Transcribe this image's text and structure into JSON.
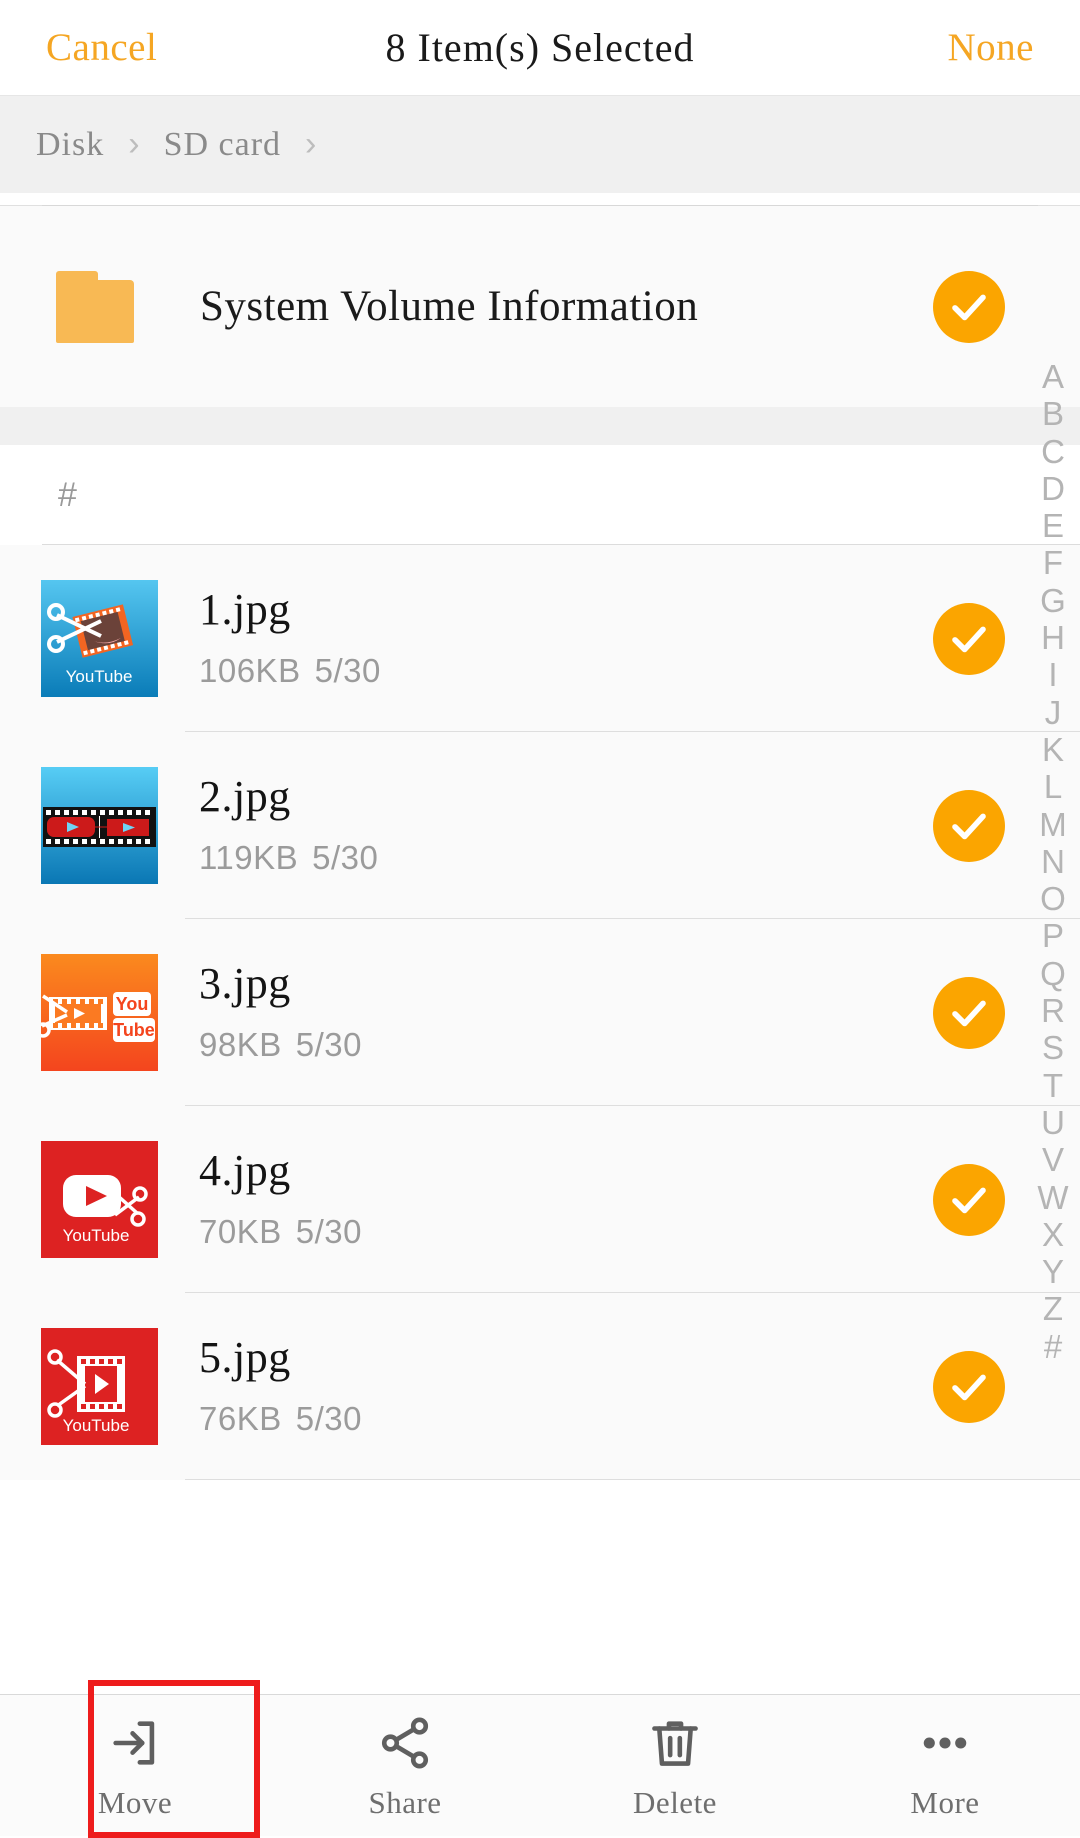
{
  "header": {
    "cancel_label": "Cancel",
    "title": "8 Item(s) Selected",
    "none_label": "None"
  },
  "breadcrumb": {
    "items": [
      "Disk",
      "SD card"
    ],
    "separator": "›"
  },
  "folder": {
    "name": "System Volume Information",
    "icon": "folder-icon",
    "selected": true
  },
  "section": {
    "hash_label": "#"
  },
  "files": [
    {
      "name": "1.jpg",
      "size": "106KB",
      "date": "5/30",
      "thumb": "youtube-scissors-filmstrip-blue",
      "badge": "YouTube",
      "selected": true
    },
    {
      "name": "2.jpg",
      "size": "119KB",
      "date": "5/30",
      "thumb": "filmstrip-two-play-blue",
      "badge": "",
      "selected": true
    },
    {
      "name": "3.jpg",
      "size": "98KB",
      "date": "5/30",
      "thumb": "filmstrip-youtube-orange",
      "badge": "You Tube",
      "selected": true
    },
    {
      "name": "4.jpg",
      "size": "70KB",
      "date": "5/30",
      "thumb": "youtube-play-scissors-red",
      "badge": "YouTube",
      "selected": true
    },
    {
      "name": "5.jpg",
      "size": "76KB",
      "date": "5/30",
      "thumb": "scissors-filmstrip-red",
      "badge": "YouTube",
      "selected": true
    }
  ],
  "alpha_index": [
    "A",
    "B",
    "C",
    "D",
    "E",
    "F",
    "G",
    "H",
    "I",
    "J",
    "K",
    "L",
    "M",
    "N",
    "O",
    "P",
    "Q",
    "R",
    "S",
    "T",
    "U",
    "V",
    "W",
    "X",
    "Y",
    "Z",
    "#"
  ],
  "toolbar": {
    "items": [
      {
        "label": "Move",
        "icon": "move-arrow-icon",
        "highlighted": true
      },
      {
        "label": "Share",
        "icon": "share-nodes-icon",
        "highlighted": false
      },
      {
        "label": "Delete",
        "icon": "trash-icon",
        "highlighted": false
      },
      {
        "label": "More",
        "icon": "ellipsis-icon",
        "highlighted": false
      }
    ]
  },
  "colors": {
    "accent_orange": "#f5a623",
    "check_orange": "#fba500",
    "folder_orange": "#f8b954",
    "highlight_red": "#ee1c1c",
    "youtube_red": "#e02020",
    "icon_gray": "#6e6e6e"
  }
}
